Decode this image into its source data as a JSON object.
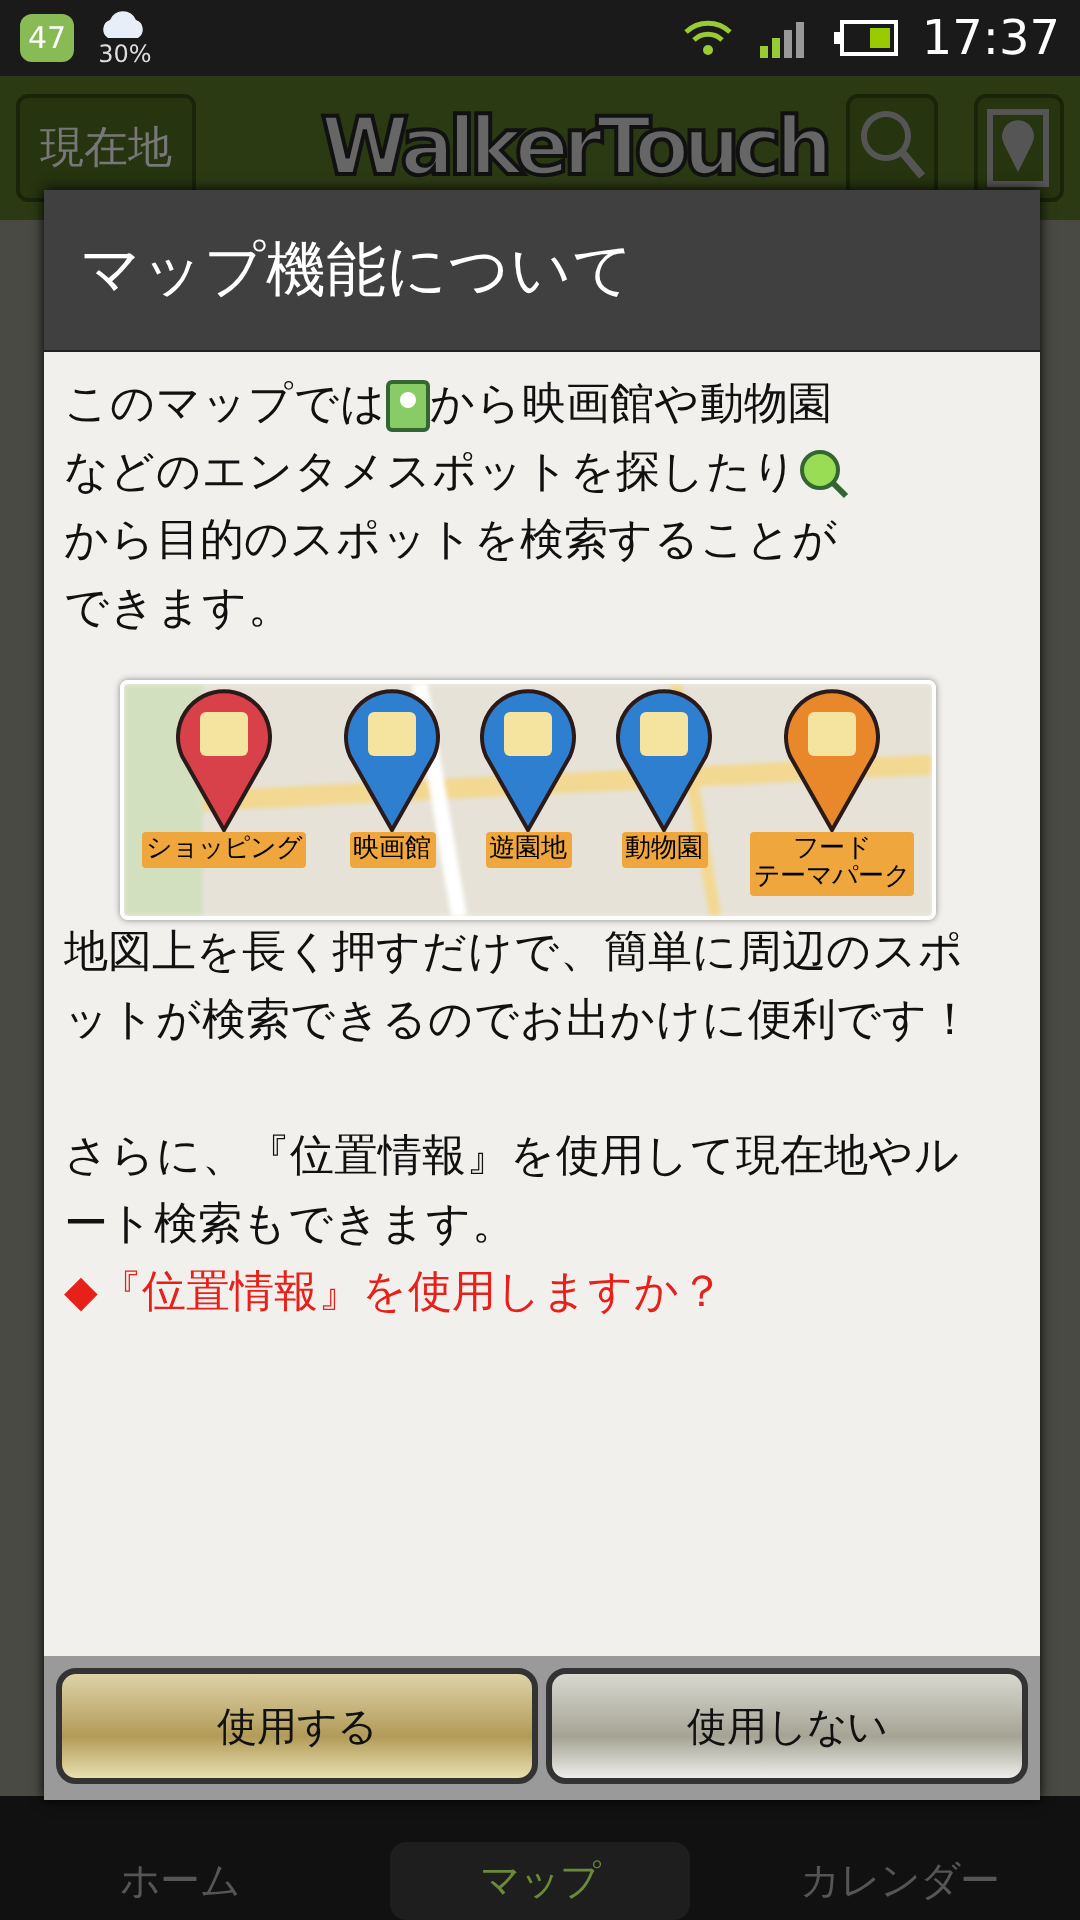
{
  "status_bar": {
    "notification_badge": "47",
    "weather_percent": "30%",
    "time": "17:37"
  },
  "app_header": {
    "location_button": "現在地",
    "logo": "WalkerTouch"
  },
  "dialog": {
    "title": "マップ機能について",
    "intro": [
      {
        "kind": "pin",
        "text": "このマップでは",
        "after": "から映画館や動物園"
      },
      {
        "kind": "search",
        "text": "などのエンタメスポットを探したり"
      },
      {
        "kind": "text",
        "text": "から目的のスポットを検索することが"
      },
      {
        "kind": "text",
        "text": "できます。"
      }
    ],
    "categories": [
      {
        "label": [
          "ショッピング"
        ],
        "color": "#d8404a"
      },
      {
        "label": [
          "映画館"
        ],
        "color": "#2f7fd0"
      },
      {
        "label": [
          "遊園地"
        ],
        "color": "#2f7fd0"
      },
      {
        "label": [
          "動物園"
        ],
        "color": "#2f7fd0"
      },
      {
        "label": [
          "フード",
          "テーマパーク"
        ],
        "color": "#e8882a"
      }
    ],
    "paragraphs": [
      "地図上を長く押すだけで、簡単に周辺のスポットが検索できるのでお出かけに便利です！",
      "さらに、『位置情報』を使用して現在地やルート検索もできます。"
    ],
    "question": "◆『位置情報』を使用しますか？",
    "buttons": [
      {
        "label": "使用する",
        "kind": "primary"
      },
      {
        "label": "使用しない",
        "kind": "secondary"
      }
    ]
  },
  "bottom_nav": [
    {
      "label": "ホーム",
      "selected": false
    },
    {
      "label": "マップ",
      "selected": true
    },
    {
      "label": "カレンダー",
      "selected": false
    }
  ]
}
